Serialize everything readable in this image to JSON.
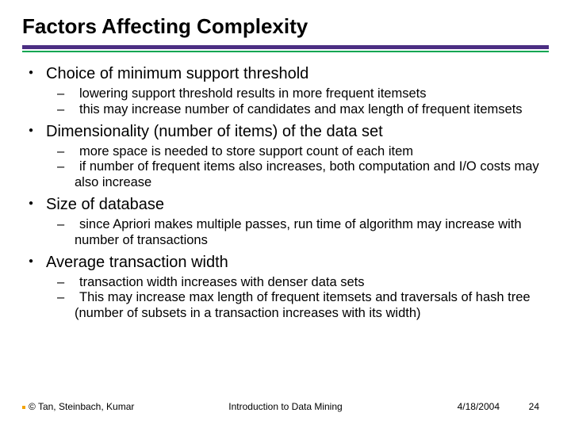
{
  "title": "Factors Affecting Complexity",
  "bullets": [
    {
      "text": "Choice of minimum support threshold",
      "subs": [
        " lowering support threshold results in more frequent itemsets",
        " this may increase number of candidates and max length of frequent itemsets"
      ]
    },
    {
      "text": "Dimensionality (number of items) of the data set",
      "subs": [
        " more space is needed to store support count of each item",
        " if number of frequent items also increases, both computation and I/O costs may also increase"
      ]
    },
    {
      "text": "Size of database",
      "subs": [
        " since Apriori makes multiple passes, run time of algorithm may increase with number of transactions"
      ]
    },
    {
      "text": "Average transaction width",
      "subs": [
        " transaction width increases with denser data sets",
        " This may increase max length of frequent itemsets and traversals of hash tree (number of subsets in a transaction increases with its width)"
      ]
    }
  ],
  "footer": {
    "authors": "© Tan, Steinbach, Kumar",
    "course": "Introduction to Data Mining",
    "date": "4/18/2004",
    "page": "24"
  }
}
